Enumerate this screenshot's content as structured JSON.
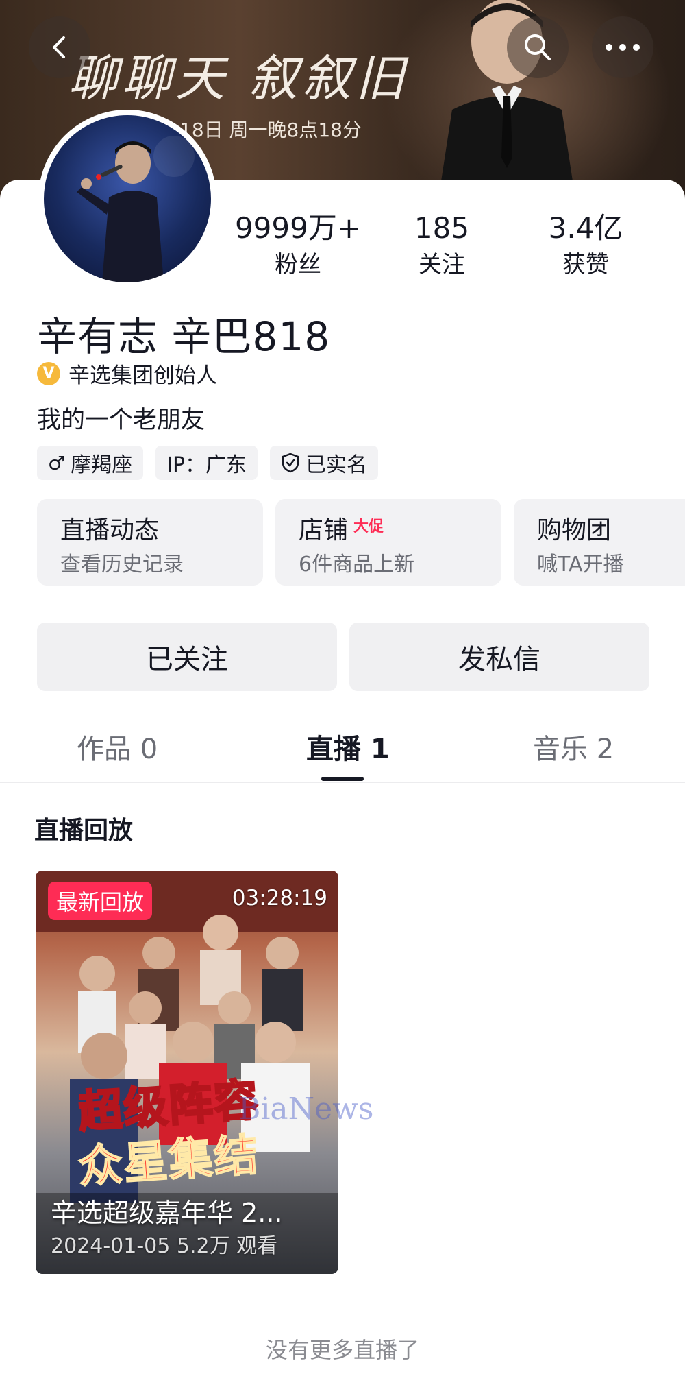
{
  "banner": {
    "title": "聊聊天 叙叙旧",
    "subtitle": "18日 周一晚8点18分"
  },
  "stats": {
    "followers": {
      "value": "9999万+",
      "label": "粉丝"
    },
    "following": {
      "value": "185",
      "label": "关注"
    },
    "likes": {
      "value": "3.4亿",
      "label": "获赞"
    }
  },
  "profile": {
    "name": "辛有志 辛巴818",
    "verified_title": "辛选集团创始人",
    "bio": "我的一个老朋友",
    "tags": [
      {
        "icon": "male-icon",
        "glyph": "♂",
        "label": "摩羯座"
      },
      {
        "label": "IP：广东"
      },
      {
        "icon": "shield-icon",
        "label": "已实名"
      }
    ]
  },
  "features": [
    {
      "title": "直播动态",
      "subtitle": "查看历史记录"
    },
    {
      "title": "店铺",
      "badge": "大促",
      "subtitle": "6件商品上新"
    },
    {
      "title": "购物团",
      "subtitle": "喊TA开播"
    }
  ],
  "actions": {
    "follow_label": "已关注",
    "message_label": "发私信"
  },
  "tabs": [
    {
      "label": "作品 0",
      "active": false
    },
    {
      "label": "直播 1",
      "active": true
    },
    {
      "label": "音乐 2",
      "active": false
    }
  ],
  "section": {
    "title": "直播回放"
  },
  "replay": {
    "badge": "最新回放",
    "duration": "03:28:19",
    "poster_line1": "超级阵容",
    "poster_line2": "众星集结",
    "title": "辛选超级嘉年华 2...",
    "meta": "2024-01-05 5.2万 观看"
  },
  "watermark": "BiaNews",
  "footer": {
    "no_more": "没有更多直播了"
  },
  "colors": {
    "accent": "#fe2c55",
    "verify": "#f6b93b",
    "text": "#161823",
    "muted": "#6b6d75"
  }
}
